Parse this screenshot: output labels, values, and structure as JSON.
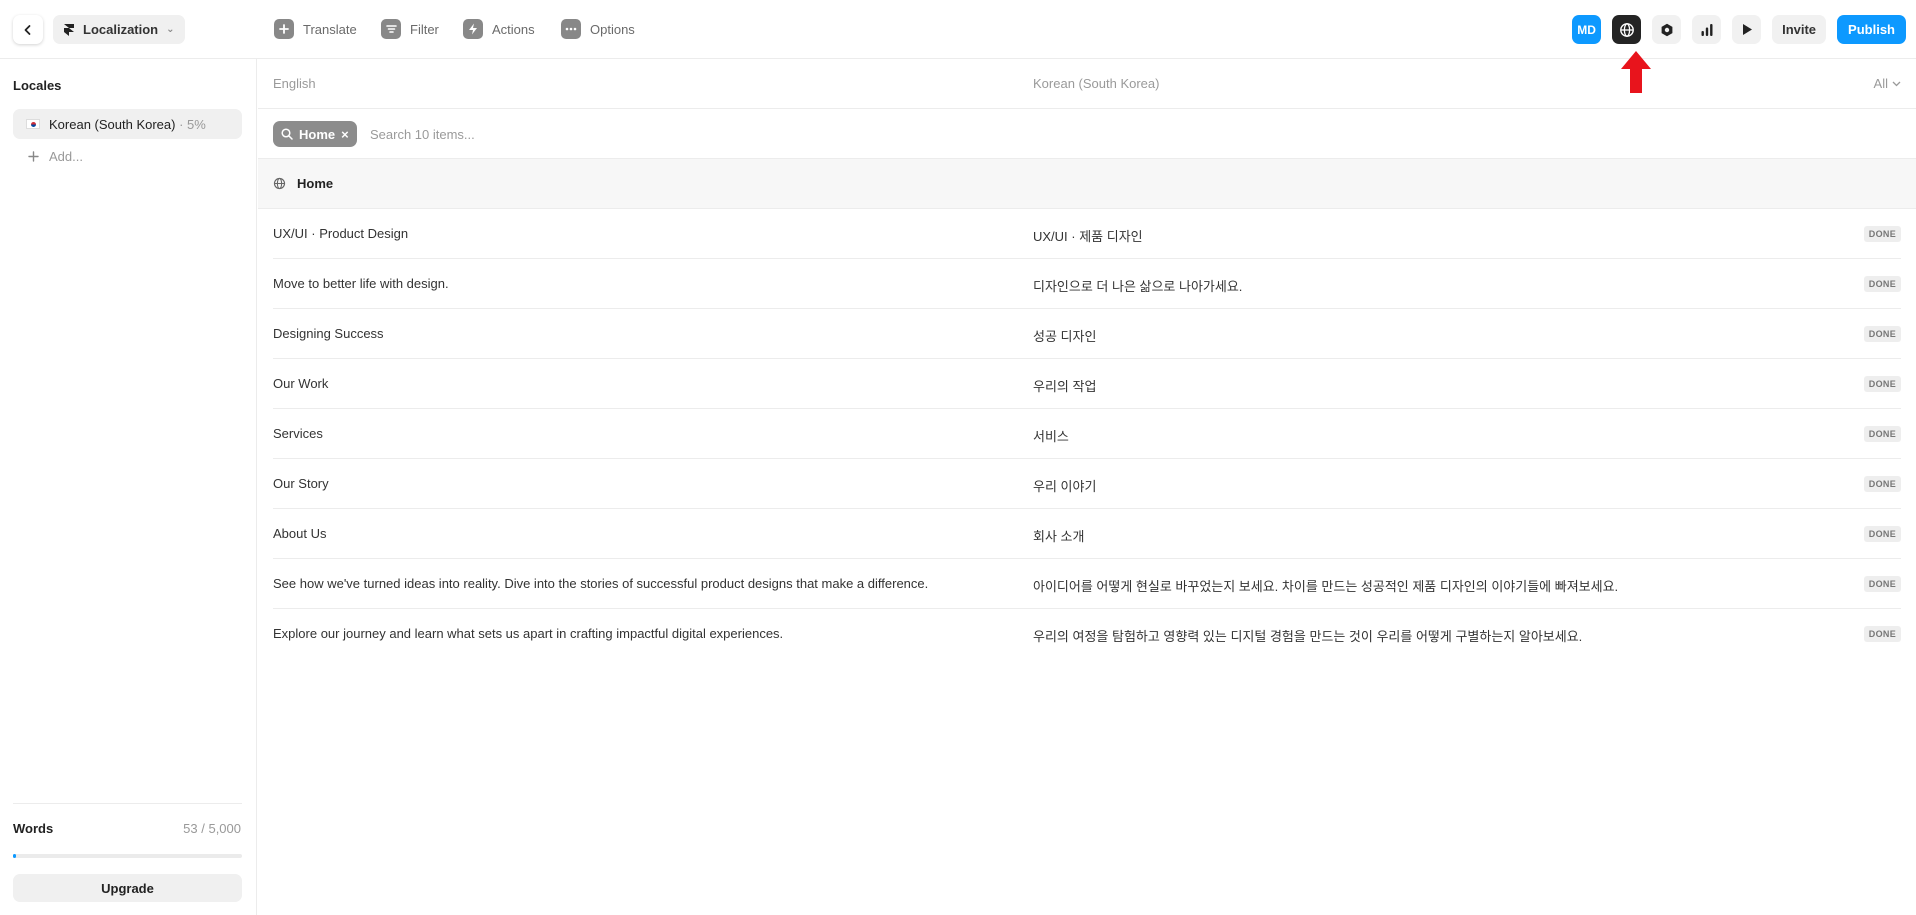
{
  "topbar": {
    "project_name": "Localization",
    "tools": [
      {
        "label": "Translate",
        "icon": "plus-icon"
      },
      {
        "label": "Filter",
        "icon": "filter-icon"
      },
      {
        "label": "Actions",
        "icon": "bolt-icon"
      },
      {
        "label": "Options",
        "icon": "more-icon"
      }
    ],
    "avatar_initials": "MD",
    "invite_label": "Invite",
    "publish_label": "Publish",
    "accent_color": "#0d99ff",
    "annotation_arrow_color": "#e8141c"
  },
  "sidebar": {
    "title": "Locales",
    "locales": [
      {
        "name": "Korean (South Korea)",
        "progress": "· 5%"
      }
    ],
    "add_label": "Add...",
    "words_label": "Words",
    "words_count": "53 / 5,000",
    "words_fraction": 0.0106,
    "upgrade_label": "Upgrade"
  },
  "main": {
    "source_language": "English",
    "target_language": "Korean (South Korea)",
    "filter_label": "All",
    "chip_label": "Home",
    "search_placeholder": "Search 10 items...",
    "group_name": "Home",
    "rows": [
      {
        "source": "UX/UI · Product Design",
        "target": "UX/UI · 제품 디자인",
        "status": "DONE"
      },
      {
        "source": "Move to better life with design.",
        "target": "디자인으로 더 나은 삶으로 나아가세요.",
        "status": "DONE"
      },
      {
        "source": "Designing Success",
        "target": "성공 디자인",
        "status": "DONE"
      },
      {
        "source": "Our Work",
        "target": "우리의 작업",
        "status": "DONE"
      },
      {
        "source": "Services",
        "target": "서비스",
        "status": "DONE"
      },
      {
        "source": "Our Story",
        "target": "우리 이야기",
        "status": "DONE"
      },
      {
        "source": "About Us",
        "target": "회사 소개",
        "status": "DONE"
      },
      {
        "source": "See how we've turned ideas into reality. Dive into the stories of successful product designs that make a difference.",
        "target": "아이디어를 어떻게 현실로 바꾸었는지 보세요. 차이를 만드는 성공적인 제품 디자인의 이야기들에 빠져보세요.",
        "status": "DONE"
      },
      {
        "source": "Explore our journey and learn what sets us apart in crafting impactful digital experiences.",
        "target": "우리의 여정을 탐험하고 영향력 있는 디지털 경험을 만드는 것이 우리를 어떻게 구별하는지 알아보세요.",
        "status": "DONE"
      }
    ]
  }
}
